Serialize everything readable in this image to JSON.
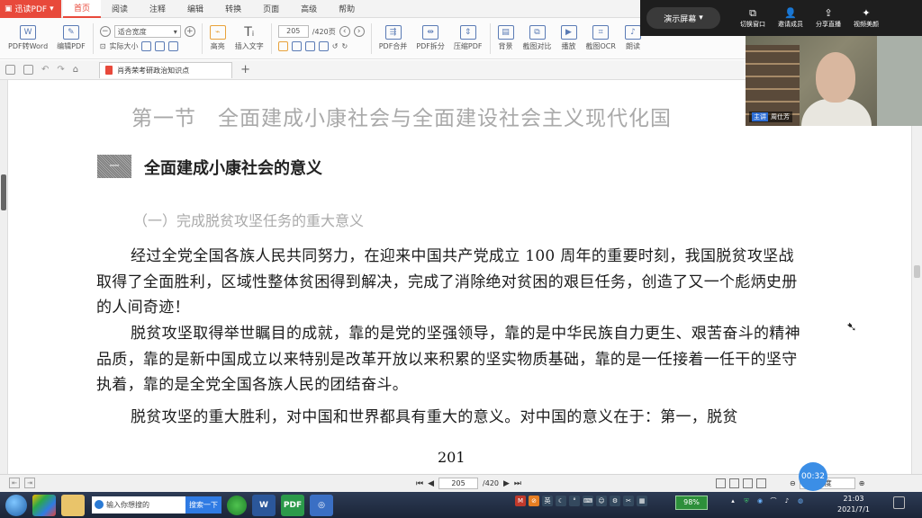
{
  "app": {
    "brand": "迅读PDF",
    "menu_tabs": [
      "首页",
      "阅读",
      "注释",
      "编辑",
      "转换",
      "页面",
      "高级",
      "帮助"
    ]
  },
  "toolbar": {
    "pdf_to_word": "PDF转Word",
    "edit_pdf": "编辑PDF",
    "zoom_value": "适合宽度",
    "actual_size": "实际大小",
    "highlight": "高亮",
    "insert_text": "插入文字",
    "page_current": "205",
    "page_total": "/420页",
    "pdf_merge": "PDF合并",
    "pdf_split": "PDF拆分",
    "compress_pdf": "压缩PDF",
    "background": "背景",
    "compare": "截图对比",
    "play": "播放",
    "ocr": "截图OCR",
    "read_aloud": "朗读"
  },
  "doc_tab": {
    "title": "肖秀荣考研政治知识点"
  },
  "document": {
    "section_title": "第一节　全面建成小康社会与全面建设社会主义现代化国",
    "heading_marker": "一",
    "heading": "全面建成小康社会的意义",
    "subheading": "（一）完成脱贫攻坚任务的重大意义",
    "paragraphs": [
      "经过全党全国各族人民共同努力，在迎来中国共产党成立 100 周年的重要时刻，我国脱贫攻坚战取得了全面胜利，区域性整体贫困得到解决，完成了消除绝对贫困的艰巨任务，创造了又一个彪炳史册的人间奇迹！",
      "脱贫攻坚取得举世瞩目的成就，靠的是党的坚强领导，靠的是中华民族自力更生、艰苦奋斗的精神品质，靠的是新中国成立以来特别是改革开放以来积累的坚实物质基础，靠的是一任接着一任干的坚守执着，靠的是全党全国各族人民的团结奋斗。",
      "脱贫攻坚的重大胜利，对中国和世界都具有重大的意义。对中国的意义在于：第一，脱贫"
    ],
    "page_number": "201"
  },
  "meeting": {
    "demo_screen": "演示屏幕",
    "switch_window": "切换窗口",
    "invite": "邀请成员",
    "share_live": "分享直播",
    "video_beauty": "视频美颜",
    "host_tag": "主讲",
    "presenter": "周仕芳"
  },
  "statusbar": {
    "page_current": "205",
    "page_total": "/420",
    "zoom": "适合宽度",
    "timer": "00:32"
  },
  "taskbar": {
    "search_placeholder": "输入你想搜的",
    "search_button": "搜索一下",
    "tray_text": "英",
    "battery": "98%",
    "time": "21:03",
    "date": "2021/7/1"
  }
}
